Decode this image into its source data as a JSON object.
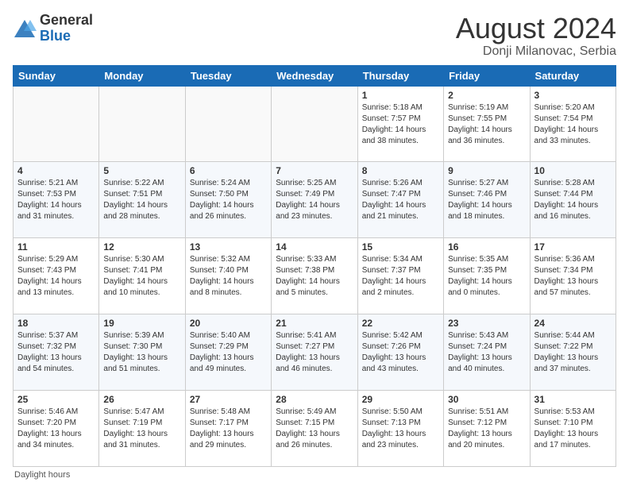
{
  "header": {
    "logo_general": "General",
    "logo_blue": "Blue",
    "month_year": "August 2024",
    "location": "Donji Milanovac, Serbia"
  },
  "footer": {
    "label": "Daylight hours"
  },
  "days_of_week": [
    "Sunday",
    "Monday",
    "Tuesday",
    "Wednesday",
    "Thursday",
    "Friday",
    "Saturday"
  ],
  "weeks": [
    [
      {
        "num": "",
        "info": ""
      },
      {
        "num": "",
        "info": ""
      },
      {
        "num": "",
        "info": ""
      },
      {
        "num": "",
        "info": ""
      },
      {
        "num": "1",
        "info": "Sunrise: 5:18 AM\nSunset: 7:57 PM\nDaylight: 14 hours\nand 38 minutes."
      },
      {
        "num": "2",
        "info": "Sunrise: 5:19 AM\nSunset: 7:55 PM\nDaylight: 14 hours\nand 36 minutes."
      },
      {
        "num": "3",
        "info": "Sunrise: 5:20 AM\nSunset: 7:54 PM\nDaylight: 14 hours\nand 33 minutes."
      }
    ],
    [
      {
        "num": "4",
        "info": "Sunrise: 5:21 AM\nSunset: 7:53 PM\nDaylight: 14 hours\nand 31 minutes."
      },
      {
        "num": "5",
        "info": "Sunrise: 5:22 AM\nSunset: 7:51 PM\nDaylight: 14 hours\nand 28 minutes."
      },
      {
        "num": "6",
        "info": "Sunrise: 5:24 AM\nSunset: 7:50 PM\nDaylight: 14 hours\nand 26 minutes."
      },
      {
        "num": "7",
        "info": "Sunrise: 5:25 AM\nSunset: 7:49 PM\nDaylight: 14 hours\nand 23 minutes."
      },
      {
        "num": "8",
        "info": "Sunrise: 5:26 AM\nSunset: 7:47 PM\nDaylight: 14 hours\nand 21 minutes."
      },
      {
        "num": "9",
        "info": "Sunrise: 5:27 AM\nSunset: 7:46 PM\nDaylight: 14 hours\nand 18 minutes."
      },
      {
        "num": "10",
        "info": "Sunrise: 5:28 AM\nSunset: 7:44 PM\nDaylight: 14 hours\nand 16 minutes."
      }
    ],
    [
      {
        "num": "11",
        "info": "Sunrise: 5:29 AM\nSunset: 7:43 PM\nDaylight: 14 hours\nand 13 minutes."
      },
      {
        "num": "12",
        "info": "Sunrise: 5:30 AM\nSunset: 7:41 PM\nDaylight: 14 hours\nand 10 minutes."
      },
      {
        "num": "13",
        "info": "Sunrise: 5:32 AM\nSunset: 7:40 PM\nDaylight: 14 hours\nand 8 minutes."
      },
      {
        "num": "14",
        "info": "Sunrise: 5:33 AM\nSunset: 7:38 PM\nDaylight: 14 hours\nand 5 minutes."
      },
      {
        "num": "15",
        "info": "Sunrise: 5:34 AM\nSunset: 7:37 PM\nDaylight: 14 hours\nand 2 minutes."
      },
      {
        "num": "16",
        "info": "Sunrise: 5:35 AM\nSunset: 7:35 PM\nDaylight: 14 hours\nand 0 minutes."
      },
      {
        "num": "17",
        "info": "Sunrise: 5:36 AM\nSunset: 7:34 PM\nDaylight: 13 hours\nand 57 minutes."
      }
    ],
    [
      {
        "num": "18",
        "info": "Sunrise: 5:37 AM\nSunset: 7:32 PM\nDaylight: 13 hours\nand 54 minutes."
      },
      {
        "num": "19",
        "info": "Sunrise: 5:39 AM\nSunset: 7:30 PM\nDaylight: 13 hours\nand 51 minutes."
      },
      {
        "num": "20",
        "info": "Sunrise: 5:40 AM\nSunset: 7:29 PM\nDaylight: 13 hours\nand 49 minutes."
      },
      {
        "num": "21",
        "info": "Sunrise: 5:41 AM\nSunset: 7:27 PM\nDaylight: 13 hours\nand 46 minutes."
      },
      {
        "num": "22",
        "info": "Sunrise: 5:42 AM\nSunset: 7:26 PM\nDaylight: 13 hours\nand 43 minutes."
      },
      {
        "num": "23",
        "info": "Sunrise: 5:43 AM\nSunset: 7:24 PM\nDaylight: 13 hours\nand 40 minutes."
      },
      {
        "num": "24",
        "info": "Sunrise: 5:44 AM\nSunset: 7:22 PM\nDaylight: 13 hours\nand 37 minutes."
      }
    ],
    [
      {
        "num": "25",
        "info": "Sunrise: 5:46 AM\nSunset: 7:20 PM\nDaylight: 13 hours\nand 34 minutes."
      },
      {
        "num": "26",
        "info": "Sunrise: 5:47 AM\nSunset: 7:19 PM\nDaylight: 13 hours\nand 31 minutes."
      },
      {
        "num": "27",
        "info": "Sunrise: 5:48 AM\nSunset: 7:17 PM\nDaylight: 13 hours\nand 29 minutes."
      },
      {
        "num": "28",
        "info": "Sunrise: 5:49 AM\nSunset: 7:15 PM\nDaylight: 13 hours\nand 26 minutes."
      },
      {
        "num": "29",
        "info": "Sunrise: 5:50 AM\nSunset: 7:13 PM\nDaylight: 13 hours\nand 23 minutes."
      },
      {
        "num": "30",
        "info": "Sunrise: 5:51 AM\nSunset: 7:12 PM\nDaylight: 13 hours\nand 20 minutes."
      },
      {
        "num": "31",
        "info": "Sunrise: 5:53 AM\nSunset: 7:10 PM\nDaylight: 13 hours\nand 17 minutes."
      }
    ]
  ]
}
